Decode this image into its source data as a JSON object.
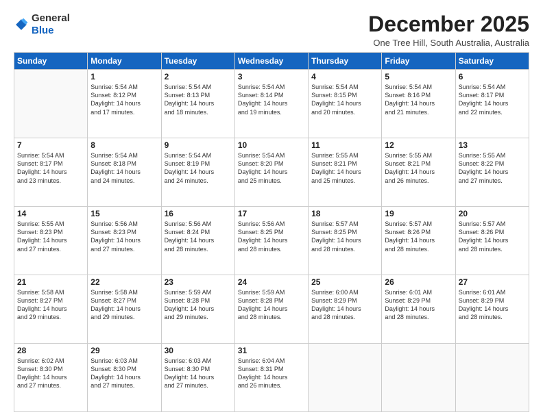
{
  "logo": {
    "general": "General",
    "blue": "Blue"
  },
  "title": "December 2025",
  "location": "One Tree Hill, South Australia, Australia",
  "days_header": [
    "Sunday",
    "Monday",
    "Tuesday",
    "Wednesday",
    "Thursday",
    "Friday",
    "Saturday"
  ],
  "weeks": [
    [
      {
        "day": "",
        "info": ""
      },
      {
        "day": "1",
        "info": "Sunrise: 5:54 AM\nSunset: 8:12 PM\nDaylight: 14 hours\nand 17 minutes."
      },
      {
        "day": "2",
        "info": "Sunrise: 5:54 AM\nSunset: 8:13 PM\nDaylight: 14 hours\nand 18 minutes."
      },
      {
        "day": "3",
        "info": "Sunrise: 5:54 AM\nSunset: 8:14 PM\nDaylight: 14 hours\nand 19 minutes."
      },
      {
        "day": "4",
        "info": "Sunrise: 5:54 AM\nSunset: 8:15 PM\nDaylight: 14 hours\nand 20 minutes."
      },
      {
        "day": "5",
        "info": "Sunrise: 5:54 AM\nSunset: 8:16 PM\nDaylight: 14 hours\nand 21 minutes."
      },
      {
        "day": "6",
        "info": "Sunrise: 5:54 AM\nSunset: 8:17 PM\nDaylight: 14 hours\nand 22 minutes."
      }
    ],
    [
      {
        "day": "7",
        "info": "Sunrise: 5:54 AM\nSunset: 8:17 PM\nDaylight: 14 hours\nand 23 minutes."
      },
      {
        "day": "8",
        "info": "Sunrise: 5:54 AM\nSunset: 8:18 PM\nDaylight: 14 hours\nand 24 minutes."
      },
      {
        "day": "9",
        "info": "Sunrise: 5:54 AM\nSunset: 8:19 PM\nDaylight: 14 hours\nand 24 minutes."
      },
      {
        "day": "10",
        "info": "Sunrise: 5:54 AM\nSunset: 8:20 PM\nDaylight: 14 hours\nand 25 minutes."
      },
      {
        "day": "11",
        "info": "Sunrise: 5:55 AM\nSunset: 8:21 PM\nDaylight: 14 hours\nand 25 minutes."
      },
      {
        "day": "12",
        "info": "Sunrise: 5:55 AM\nSunset: 8:21 PM\nDaylight: 14 hours\nand 26 minutes."
      },
      {
        "day": "13",
        "info": "Sunrise: 5:55 AM\nSunset: 8:22 PM\nDaylight: 14 hours\nand 27 minutes."
      }
    ],
    [
      {
        "day": "14",
        "info": "Sunrise: 5:55 AM\nSunset: 8:23 PM\nDaylight: 14 hours\nand 27 minutes."
      },
      {
        "day": "15",
        "info": "Sunrise: 5:56 AM\nSunset: 8:23 PM\nDaylight: 14 hours\nand 27 minutes."
      },
      {
        "day": "16",
        "info": "Sunrise: 5:56 AM\nSunset: 8:24 PM\nDaylight: 14 hours\nand 28 minutes."
      },
      {
        "day": "17",
        "info": "Sunrise: 5:56 AM\nSunset: 8:25 PM\nDaylight: 14 hours\nand 28 minutes."
      },
      {
        "day": "18",
        "info": "Sunrise: 5:57 AM\nSunset: 8:25 PM\nDaylight: 14 hours\nand 28 minutes."
      },
      {
        "day": "19",
        "info": "Sunrise: 5:57 AM\nSunset: 8:26 PM\nDaylight: 14 hours\nand 28 minutes."
      },
      {
        "day": "20",
        "info": "Sunrise: 5:57 AM\nSunset: 8:26 PM\nDaylight: 14 hours\nand 28 minutes."
      }
    ],
    [
      {
        "day": "21",
        "info": "Sunrise: 5:58 AM\nSunset: 8:27 PM\nDaylight: 14 hours\nand 29 minutes."
      },
      {
        "day": "22",
        "info": "Sunrise: 5:58 AM\nSunset: 8:27 PM\nDaylight: 14 hours\nand 29 minutes."
      },
      {
        "day": "23",
        "info": "Sunrise: 5:59 AM\nSunset: 8:28 PM\nDaylight: 14 hours\nand 29 minutes."
      },
      {
        "day": "24",
        "info": "Sunrise: 5:59 AM\nSunset: 8:28 PM\nDaylight: 14 hours\nand 28 minutes."
      },
      {
        "day": "25",
        "info": "Sunrise: 6:00 AM\nSunset: 8:29 PM\nDaylight: 14 hours\nand 28 minutes."
      },
      {
        "day": "26",
        "info": "Sunrise: 6:01 AM\nSunset: 8:29 PM\nDaylight: 14 hours\nand 28 minutes."
      },
      {
        "day": "27",
        "info": "Sunrise: 6:01 AM\nSunset: 8:29 PM\nDaylight: 14 hours\nand 28 minutes."
      }
    ],
    [
      {
        "day": "28",
        "info": "Sunrise: 6:02 AM\nSunset: 8:30 PM\nDaylight: 14 hours\nand 27 minutes."
      },
      {
        "day": "29",
        "info": "Sunrise: 6:03 AM\nSunset: 8:30 PM\nDaylight: 14 hours\nand 27 minutes."
      },
      {
        "day": "30",
        "info": "Sunrise: 6:03 AM\nSunset: 8:30 PM\nDaylight: 14 hours\nand 27 minutes."
      },
      {
        "day": "31",
        "info": "Sunrise: 6:04 AM\nSunset: 8:31 PM\nDaylight: 14 hours\nand 26 minutes."
      },
      {
        "day": "",
        "info": ""
      },
      {
        "day": "",
        "info": ""
      },
      {
        "day": "",
        "info": ""
      }
    ]
  ]
}
